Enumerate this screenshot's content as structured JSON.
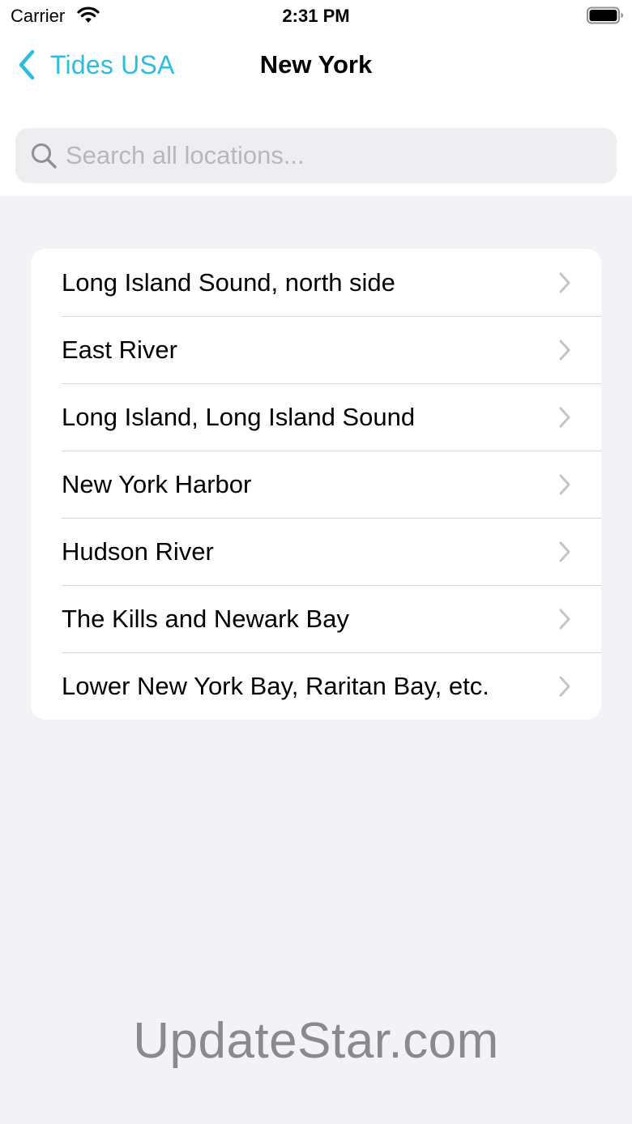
{
  "status_bar": {
    "carrier": "Carrier",
    "time": "2:31 PM",
    "wifi_icon": "wifi-icon",
    "battery_icon": "battery-full-icon"
  },
  "nav": {
    "back_label": "Tides USA",
    "title": "New York"
  },
  "search": {
    "placeholder": "Search all locations...",
    "value": ""
  },
  "locations": [
    {
      "label": "Long Island Sound, north side"
    },
    {
      "label": "East River"
    },
    {
      "label": "Long Island, Long Island Sound"
    },
    {
      "label": "New York Harbor"
    },
    {
      "label": "Hudson River"
    },
    {
      "label": "The Kills and Newark Bay"
    },
    {
      "label": "Lower New York Bay, Raritan Bay, etc."
    }
  ],
  "watermark": "UpdateStar.com",
  "colors": {
    "accent": "#2cbde0",
    "background": "#f2f2f7",
    "card": "#ffffff",
    "chevron": "#c4c4c7"
  }
}
